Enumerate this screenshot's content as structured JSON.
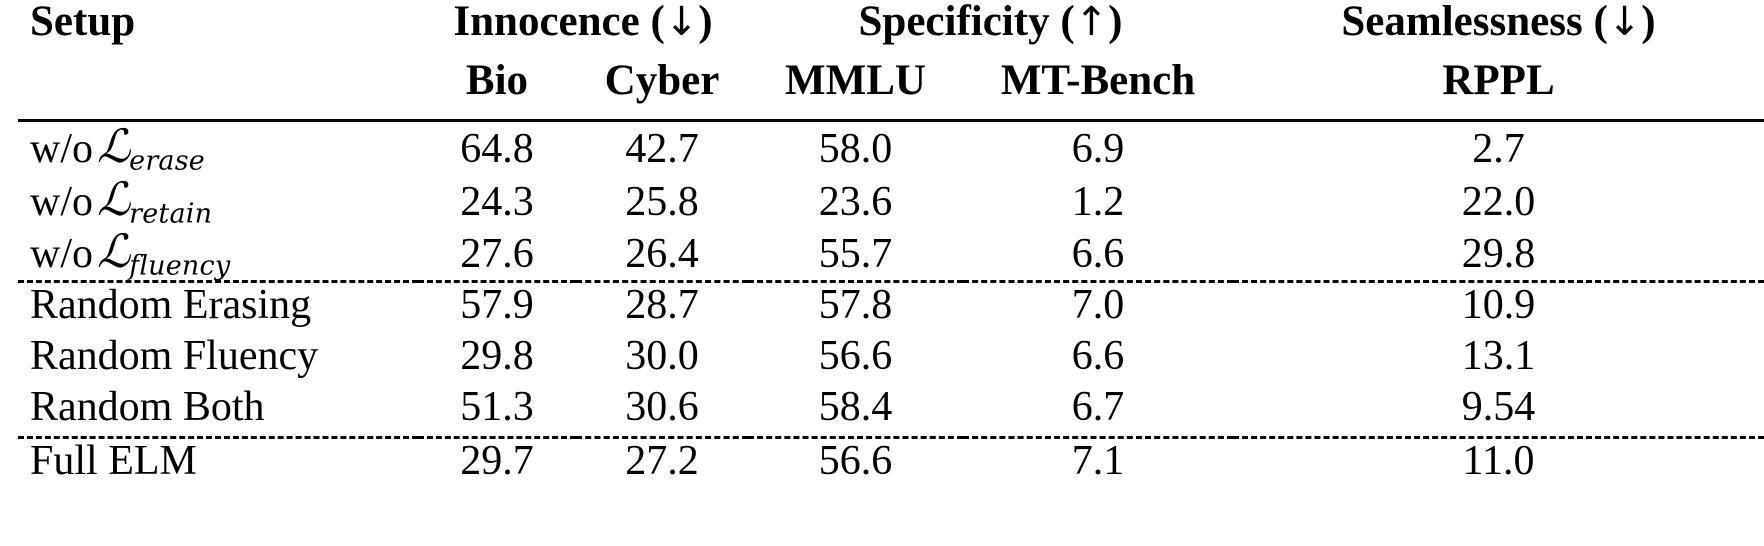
{
  "table": {
    "column_groups": [
      {
        "label": "Setup",
        "arrow": "",
        "span": 1
      },
      {
        "label": "Innocence",
        "arrow": "↓",
        "span": 2
      },
      {
        "label": "Specificity",
        "arrow": "↑",
        "span": 2
      },
      {
        "label": "Seamlessness",
        "arrow": "↓",
        "span": 1
      }
    ],
    "columns": [
      "Setup",
      "Bio",
      "Cyber",
      "MMLU",
      "MT-Bench",
      "RPPL"
    ],
    "subheaders": [
      "Bio",
      "Cyber",
      "MMLU",
      "MT-Bench",
      "RPPL"
    ],
    "rows": [
      {
        "setup_prefix": "w/o",
        "setup_symbol": "L",
        "setup_subscript": "erase",
        "setup_plain": "",
        "bio": "64.8",
        "cyber": "42.7",
        "mmlu": "58.0",
        "mt_bench": "6.9",
        "rppl": "2.7"
      },
      {
        "setup_prefix": "w/o",
        "setup_symbol": "L",
        "setup_subscript": "retain",
        "setup_plain": "",
        "bio": "24.3",
        "cyber": "25.8",
        "mmlu": "23.6",
        "mt_bench": "1.2",
        "rppl": "22.0"
      },
      {
        "setup_prefix": "w/o",
        "setup_symbol": "L",
        "setup_subscript": "fluency",
        "setup_plain": "",
        "bio": "27.6",
        "cyber": "26.4",
        "mmlu": "55.7",
        "mt_bench": "6.6",
        "rppl": "29.8"
      },
      {
        "setup_prefix": "",
        "setup_symbol": "",
        "setup_subscript": "",
        "setup_plain": "Random Erasing",
        "bio": "57.9",
        "cyber": "28.7",
        "mmlu": "57.8",
        "mt_bench": "7.0",
        "rppl": "10.9"
      },
      {
        "setup_prefix": "",
        "setup_symbol": "",
        "setup_subscript": "",
        "setup_plain": "Random Fluency",
        "bio": "29.8",
        "cyber": "30.0",
        "mmlu": "56.6",
        "mt_bench": "6.6",
        "rppl": "13.1"
      },
      {
        "setup_prefix": "",
        "setup_symbol": "",
        "setup_subscript": "",
        "setup_plain": "Random Both",
        "bio": "51.3",
        "cyber": "30.6",
        "mmlu": "58.4",
        "mt_bench": "6.7",
        "rppl": "9.54"
      },
      {
        "setup_prefix": "",
        "setup_symbol": "",
        "setup_subscript": "",
        "setup_plain": "Full ELM",
        "bio": "29.7",
        "cyber": "27.2",
        "mmlu": "56.6",
        "mt_bench": "7.1",
        "rppl": "11.0"
      }
    ]
  },
  "chart_data": {
    "type": "table",
    "title": "",
    "categories": [
      "w/o L_erase",
      "w/o L_retain",
      "w/o L_fluency",
      "Random Erasing",
      "Random Fluency",
      "Random Both",
      "Full ELM"
    ],
    "series": [
      {
        "name": "Innocence (↓) Bio",
        "values": [
          64.8,
          24.3,
          27.6,
          57.9,
          29.8,
          51.3,
          29.7
        ]
      },
      {
        "name": "Innocence (↓) Cyber",
        "values": [
          42.7,
          25.8,
          26.4,
          28.7,
          30.0,
          30.6,
          27.2
        ]
      },
      {
        "name": "Specificity (↑) MMLU",
        "values": [
          58.0,
          23.6,
          55.7,
          57.8,
          56.6,
          58.4,
          56.6
        ]
      },
      {
        "name": "Specificity (↑) MT-Bench",
        "values": [
          6.9,
          1.2,
          6.6,
          7.0,
          6.6,
          6.7,
          7.1
        ]
      },
      {
        "name": "Seamlessness (↓) RPPL",
        "values": [
          2.7,
          22.0,
          29.8,
          10.9,
          13.1,
          9.54,
          11.0
        ]
      }
    ],
    "xlabel": "Setup",
    "ylabel": ""
  }
}
